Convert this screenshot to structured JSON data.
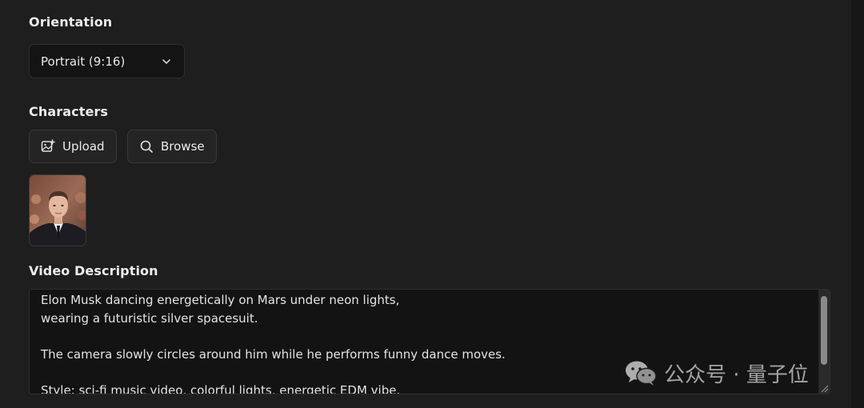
{
  "orientation": {
    "label": "Orientation",
    "selected": "Portrait (9:16)"
  },
  "characters": {
    "label": "Characters",
    "upload_label": "Upload",
    "browse_label": "Browse"
  },
  "video_description": {
    "label": "Video Description",
    "value": "Elon Musk dancing energetically on Mars under neon lights,\nwearing a futuristic silver spacesuit.\n\nThe camera slowly circles around him while he performs funny dance moves.\n\nStyle: sci-fi music video, colorful lights, energetic EDM vibe."
  },
  "watermark": {
    "text": "公众号 · 量子位"
  },
  "icons": {
    "select_chevron": "chevron-down-icon",
    "upload": "image-plus-icon",
    "browse": "search-icon",
    "watermark_logo": "wechat-icon"
  }
}
